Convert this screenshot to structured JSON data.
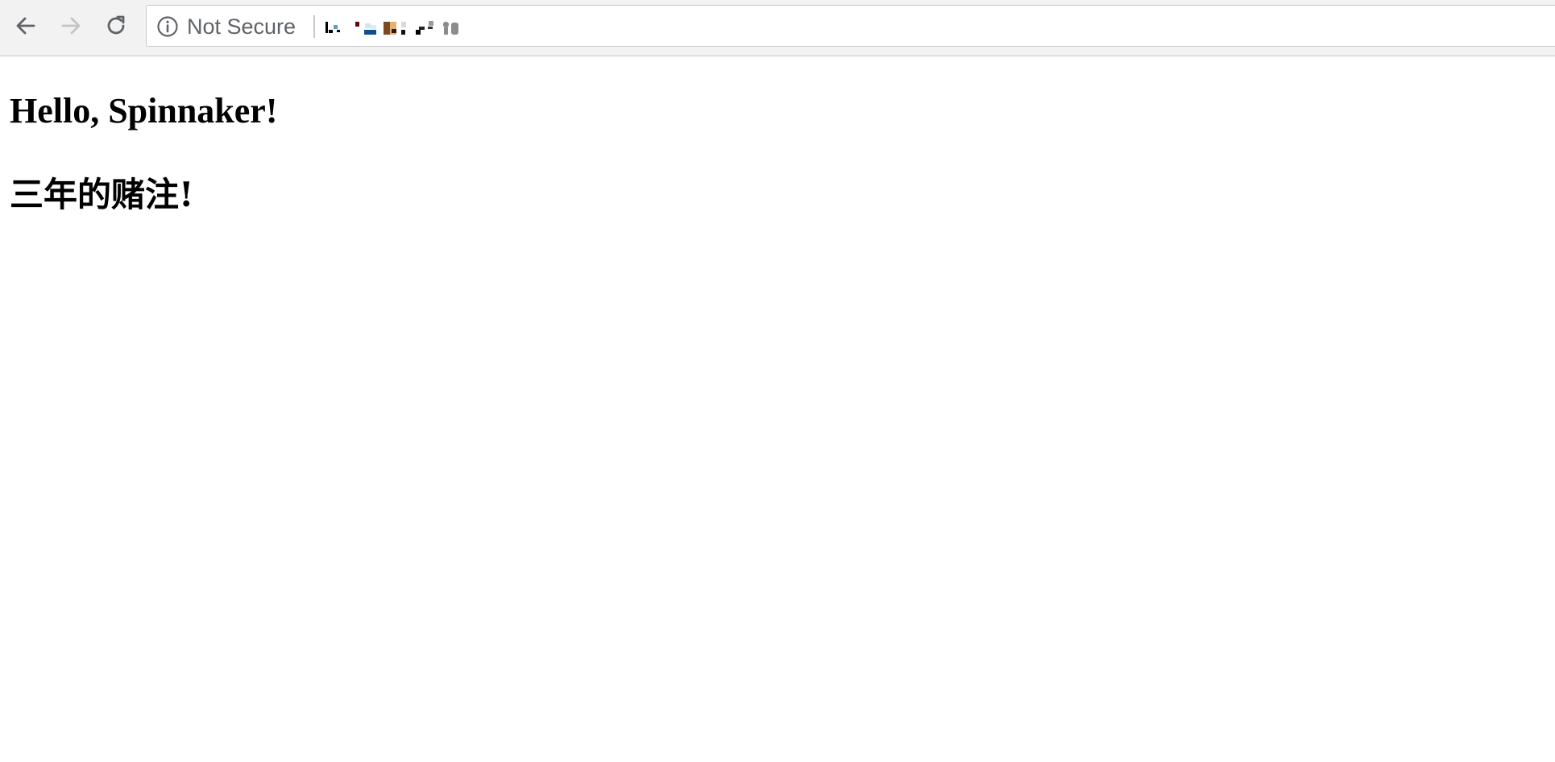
{
  "browser": {
    "security_label": "Not Secure",
    "nav": {
      "back_icon": "arrow-left-icon",
      "forward_icon": "arrow-right-icon",
      "reload_icon": "reload-icon",
      "forward_enabled": false
    },
    "info_icon": "info-circle-icon",
    "url_obscured": true
  },
  "page": {
    "heading": "Hello, Spinnaker!",
    "subheading": "三年的赌注!"
  },
  "colors": {
    "toolbar_bg": "#f2f2f2",
    "icon_active": "#5f6368",
    "icon_disabled": "#c4c4c4",
    "text": "#000000"
  }
}
